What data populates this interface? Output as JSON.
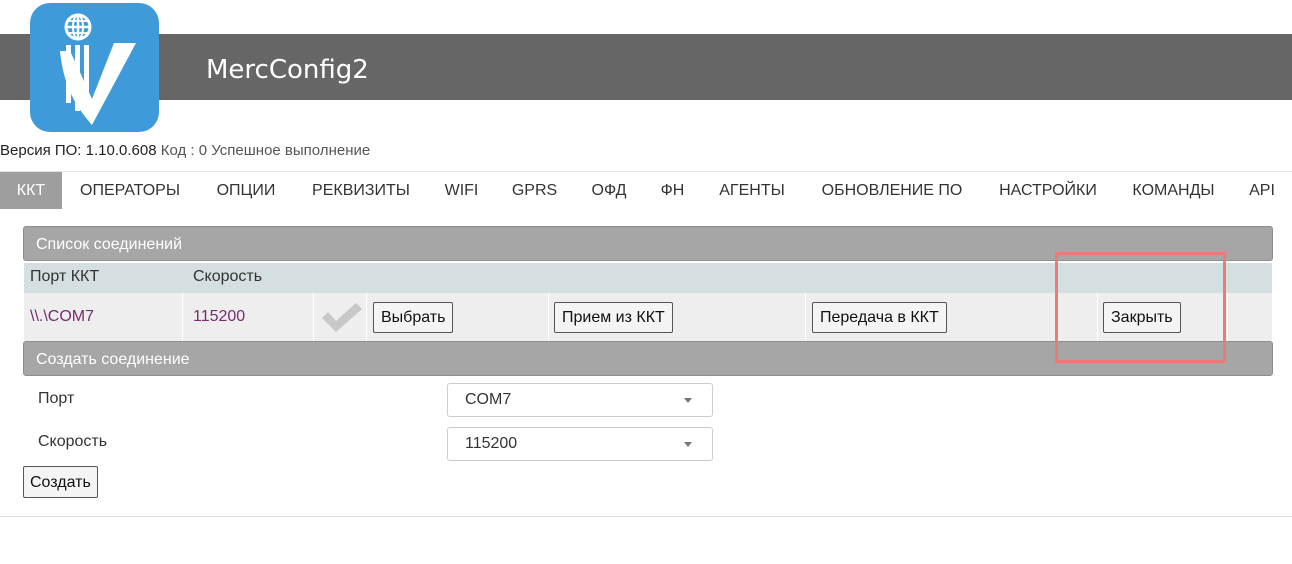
{
  "app": {
    "title": "MercConfig2",
    "logo_icon": "merc-logo-icon",
    "brand_color": "#3e9ad9",
    "header_color": "#666666"
  },
  "status": {
    "version_label": "Версия ПО:",
    "version_value": "1.10.0.608",
    "code_label": "Код :",
    "code_value": "0",
    "result_text": "Успешное выполнение"
  },
  "tabs": [
    {
      "label": "ККТ",
      "active": true
    },
    {
      "label": "ОПЕРАТОРЫ"
    },
    {
      "label": "ОПЦИИ"
    },
    {
      "label": "РЕКВИЗИТЫ"
    },
    {
      "label": "WIFI"
    },
    {
      "label": "GPRS"
    },
    {
      "label": "ОФД"
    },
    {
      "label": "ФН"
    },
    {
      "label": "АГЕНТЫ"
    },
    {
      "label": "ОБНОВЛЕНИЕ ПО"
    },
    {
      "label": "НАСТРОЙКИ"
    },
    {
      "label": "КОМАНДЫ"
    },
    {
      "label": "API"
    }
  ],
  "connections": {
    "title": "Список соединений",
    "columns": [
      "Порт ККТ",
      "Скорость"
    ],
    "rows": [
      {
        "port": "\\\\.\\COM7",
        "speed": "115200",
        "connected_icon": "checkmark-icon",
        "select_label": "Выбрать",
        "receive_label": "Прием из ККТ",
        "send_label": "Передача в ККТ",
        "close_label": "Закрыть"
      }
    ]
  },
  "create": {
    "title": "Создать соединение",
    "port_label": "Порт",
    "port_value": "COM7",
    "speed_label": "Скорость",
    "speed_value": "115200",
    "create_label": "Создать"
  },
  "highlight_color": "#ee7a75"
}
